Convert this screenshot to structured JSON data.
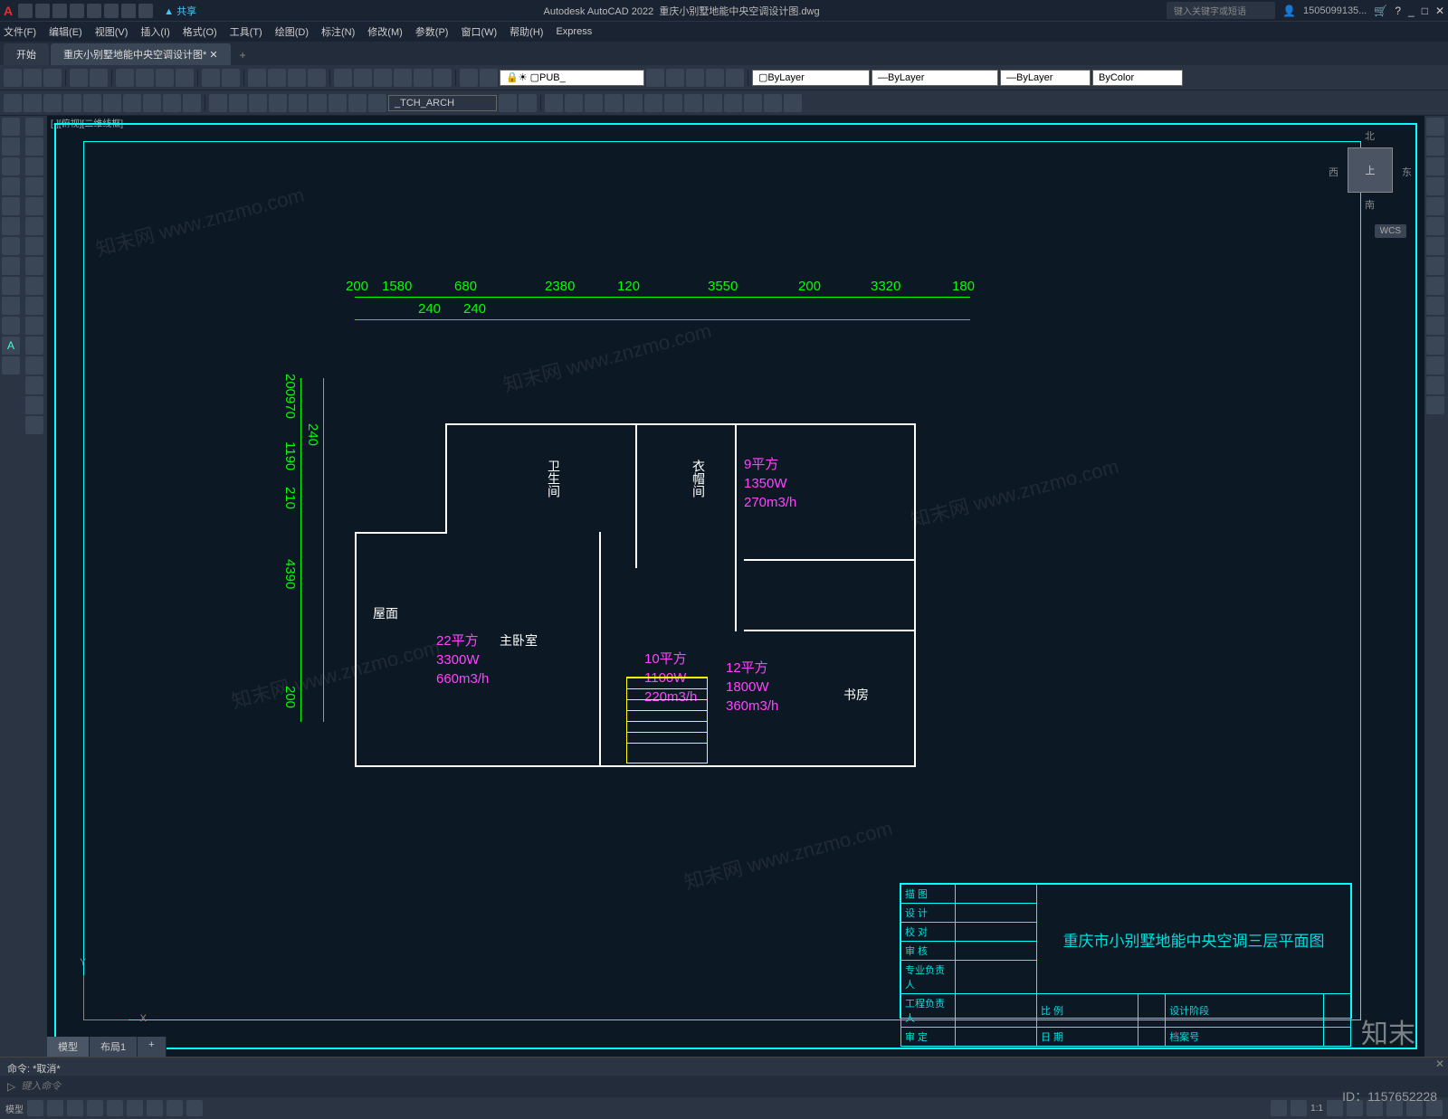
{
  "app": {
    "name": "Autodesk AutoCAD 2022",
    "document": "重庆小别墅地能中央空调设计图.dwg",
    "share": "共享",
    "search_placeholder": "键入关键字或短语",
    "user": "1505099135...",
    "window_buttons": [
      "_",
      "□",
      "✕"
    ]
  },
  "menubar": [
    "文件(F)",
    "编辑(E)",
    "视图(V)",
    "插入(I)",
    "格式(O)",
    "工具(T)",
    "绘图(D)",
    "标注(N)",
    "修改(M)",
    "参数(P)",
    "窗口(W)",
    "帮助(H)",
    "Express"
  ],
  "filetabs": {
    "start": "开始",
    "active": "重庆小别墅地能中央空调设计图*",
    "plus": "+"
  },
  "toolbar_combos": {
    "layer": "PUB_",
    "command": "_TCH_ARCH",
    "prop1": "ByLayer",
    "prop2": "ByLayer",
    "prop3": "ByLayer",
    "prop4": "ByColor"
  },
  "viewcube": {
    "top": "上",
    "north": "北",
    "south": "南",
    "east": "东",
    "west": "西",
    "wcs": "WCS"
  },
  "viewport_label": "[-][俯视][二维线框]",
  "ucs": {
    "x": "X",
    "y": "Y"
  },
  "dimensions": {
    "top": [
      "200",
      "1580",
      "680",
      "2380",
      "120",
      "3550",
      "200",
      "3320",
      "180"
    ],
    "top2": [
      "240",
      "240"
    ],
    "left": [
      "200",
      "970",
      "1190",
      "210",
      "4390",
      "200"
    ],
    "left2": [
      "240"
    ]
  },
  "rooms": {
    "bathroom": "卫生间",
    "closet": "衣帽间",
    "roof": "屋面",
    "master": "主卧室",
    "study": "书房"
  },
  "hvac_data": [
    {
      "area": "9平方",
      "power": "1350W",
      "flow": "270m3/h"
    },
    {
      "area": "22平方",
      "power": "3300W",
      "flow": "660m3/h"
    },
    {
      "area": "10平方",
      "power": "1100W",
      "flow": "220m3/h"
    },
    {
      "area": "12平方",
      "power": "1800W",
      "flow": "360m3/h"
    }
  ],
  "titleblock": {
    "rows": [
      "描 图",
      "设 计",
      "校 对",
      "审 核",
      "专业负责人",
      "工程负责人",
      "审 定"
    ],
    "drawing_title": "重庆市小别墅地能中央空调三层平面图",
    "bottom": {
      "scale": "比 例",
      "date": "日 期",
      "phase": "设计阶段",
      "archive": "档案号"
    }
  },
  "modeltabs": [
    "模型",
    "布局1"
  ],
  "command": {
    "history": "命令: *取消*",
    "prompt_icon": "▷",
    "placeholder": "键入命令"
  },
  "statusbar": {
    "model": "模型",
    "scale": "1:1"
  },
  "watermarks": {
    "url": "www.znzmo.com",
    "brand": "知末网",
    "big_brand": "知末",
    "id": "ID：1157652228"
  }
}
